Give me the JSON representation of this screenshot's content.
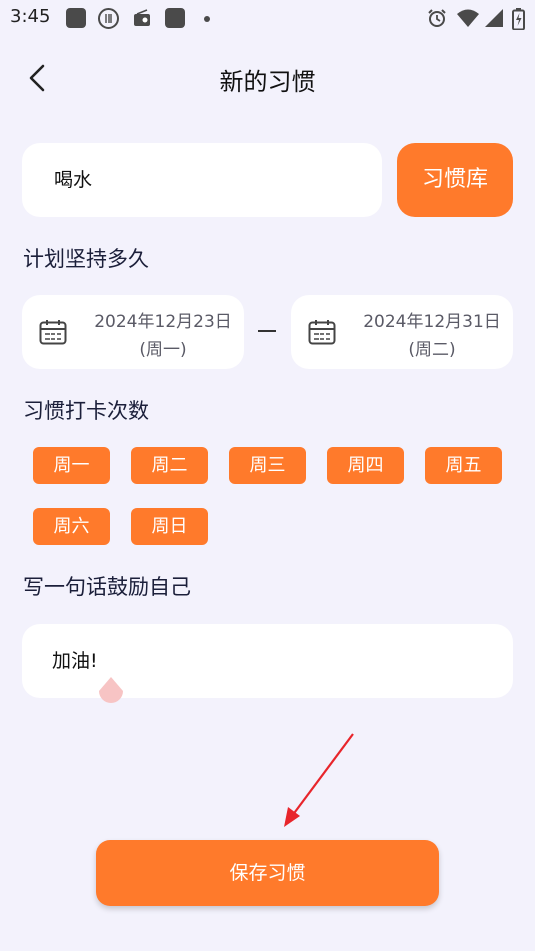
{
  "status_bar": {
    "time": "3:45",
    "left_icons": [
      "app-icon",
      "restaurant-icon",
      "radio-icon",
      "app-icon"
    ],
    "right_icons": [
      "alarm-icon",
      "wifi-icon",
      "signal-icon",
      "battery-icon"
    ]
  },
  "header": {
    "back_icon": "chevron-left-icon",
    "title": "新的习惯"
  },
  "habit": {
    "name_value": "喝水",
    "library_button": "习惯库"
  },
  "duration": {
    "label": "计划坚持多久",
    "start": {
      "date": "2024年12月23日",
      "weekday": "(周一)"
    },
    "end": {
      "date": "2024年12月31日",
      "weekday": "(周二)"
    }
  },
  "frequency": {
    "label": "习惯打卡次数",
    "days": [
      "周一",
      "周二",
      "周三",
      "周四",
      "周五",
      "周六",
      "周日"
    ]
  },
  "motto": {
    "label": "写一句话鼓励自己",
    "value": "加油!"
  },
  "save_button": "保存习惯",
  "colors": {
    "accent": "#ff7a2b",
    "background": "#f3f2fc",
    "annotation_arrow": "#e8252b"
  }
}
